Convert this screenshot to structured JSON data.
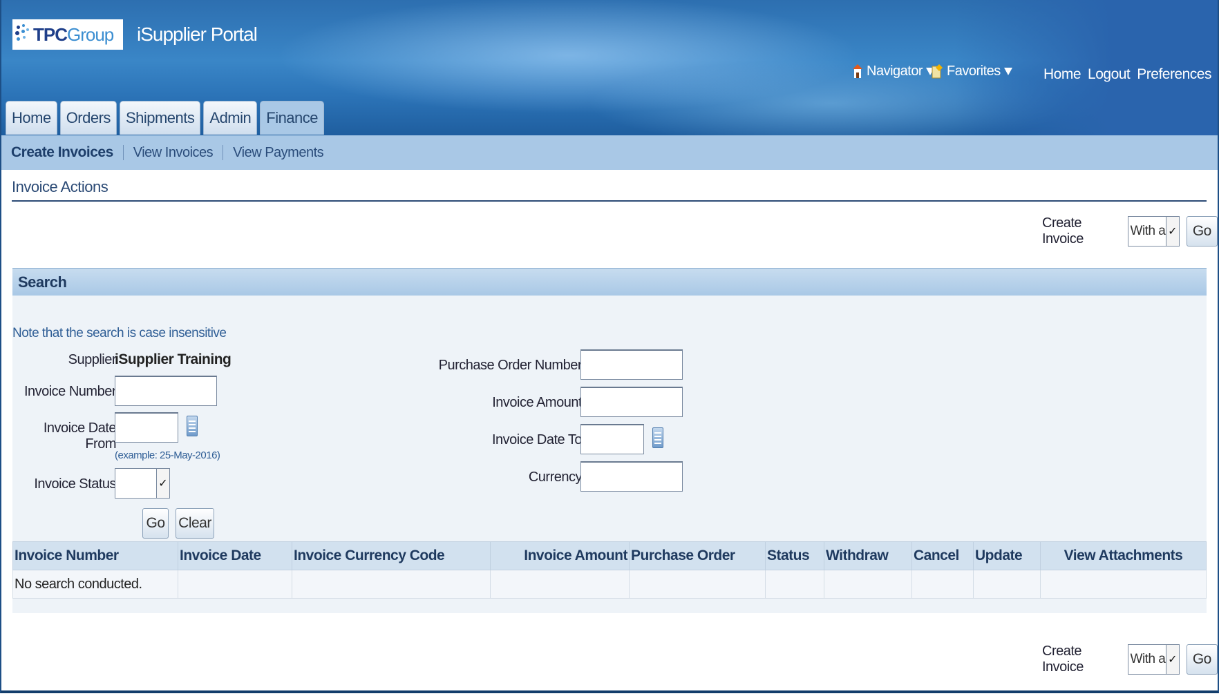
{
  "header": {
    "logo_main": "TPC",
    "logo_group": "Group",
    "portal_title": "iSupplier Portal",
    "navigator_label": "Navigator",
    "favorites_label": "Favorites",
    "links": [
      "Home",
      "Logout",
      "Preferences"
    ]
  },
  "tabs": [
    "Home",
    "Orders",
    "Shipments",
    "Admin",
    "Finance"
  ],
  "active_tab": "Finance",
  "subtabs": [
    "Create Invoices",
    "View Invoices",
    "View Payments"
  ],
  "active_subtab": "Create Invoices",
  "page": {
    "heading": "Invoice Actions",
    "create_invoice_label": "Create Invoice",
    "create_invoice_option": "With a PO",
    "go_label": "Go"
  },
  "search": {
    "title": "Search",
    "note": "Note that the search is case insensitive",
    "supplier_label": "Supplier",
    "supplier_value": "iSupplier Training",
    "invoice_number_label": "Invoice Number",
    "invoice_date_from_label": "Invoice Date From",
    "date_example": "(example: 25-May-2016)",
    "invoice_status_label": "Invoice Status",
    "po_number_label": "Purchase Order Number",
    "invoice_amount_label": "Invoice Amount",
    "invoice_date_to_label": "Invoice Date To",
    "currency_label": "Currency",
    "go_label": "Go",
    "clear_label": "Clear"
  },
  "results": {
    "columns": [
      "Invoice Number",
      "Invoice Date",
      "Invoice Currency Code",
      "Invoice Amount",
      "Purchase Order",
      "Status",
      "Withdraw",
      "Cancel",
      "Update",
      "View Attachments"
    ],
    "empty_message": "No search conducted."
  },
  "colors": {
    "header_blue": "#2d6fb0",
    "subtab_bar": "#a9c8e6",
    "region_bg": "#eef3f8",
    "table_header": "#d2e1ef"
  }
}
